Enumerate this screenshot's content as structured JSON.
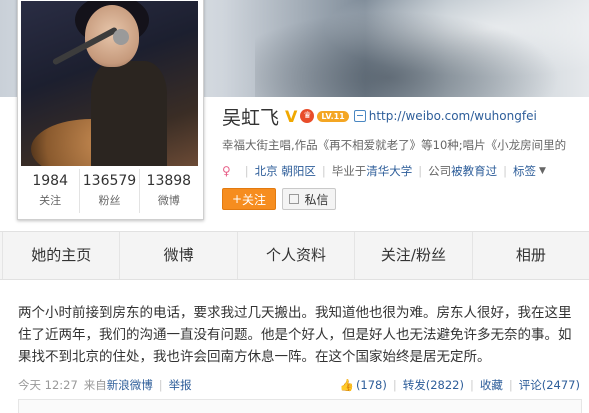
{
  "profile": {
    "name": "吴虹飞",
    "verified_badge": "V",
    "level": "LV.11",
    "url": "http://weibo.com/wuhongfei",
    "description": "幸福大街主唱,作品《再不相爱就老了》等10种;唱片《小龙房间里的",
    "location": "北京 朝阳区",
    "school_prefix": "毕业于",
    "school": "清华大学",
    "company_prefix": "公司",
    "company": "被教育过",
    "tags_label": "标签",
    "follow_label": "关注",
    "message_label": "私信"
  },
  "stats": [
    {
      "value": "1984",
      "label": "关注"
    },
    {
      "value": "136579",
      "label": "粉丝"
    },
    {
      "value": "13898",
      "label": "微博"
    }
  ],
  "tabs": [
    "她的主页",
    "微博",
    "个人资料",
    "关注/粉丝",
    "相册"
  ],
  "post": {
    "text": "两个小时前接到房东的电话，要求我过几天搬出。我知道他也很为难。房东人很好，我在这里住了近两年，我们的沟通一直没有问题。他是个好人，但是好人也无法避免许多无奈的事。如果找不到北京的住处，我也许会回南方休息一阵。在这个国家始终是居无定所。",
    "time": "今天 12:27",
    "source_prefix": "来自",
    "source": "新浪微博",
    "report": "举报",
    "likes": "(178)",
    "repost": "转发(2822)",
    "favorite": "收藏",
    "comment": "评论(2477)"
  }
}
